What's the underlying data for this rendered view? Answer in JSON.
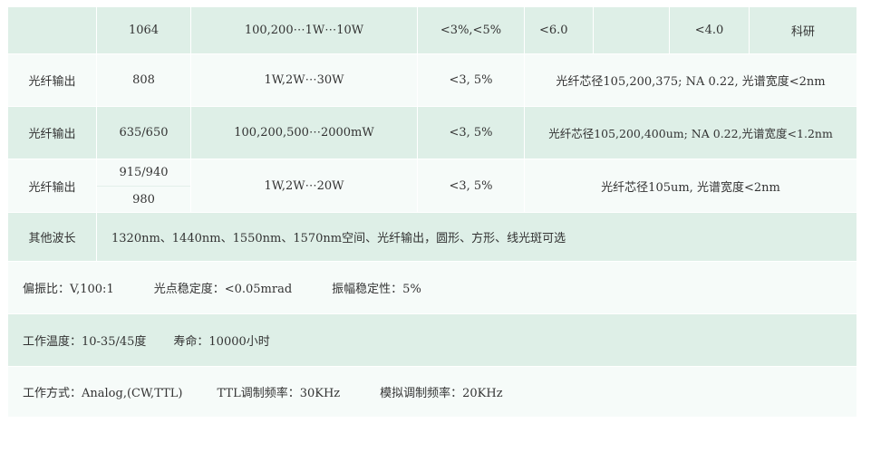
{
  "rows": [
    {
      "name": "",
      "wavelength": "1064",
      "power": "100,200⋯1W⋯10W",
      "stability": "<3%,<5%",
      "col5": "<6.0",
      "col6": "",
      "col7": "<4.0",
      "col8": "科研"
    },
    {
      "name": "光纤输出",
      "wavelength": "808",
      "power": "1W,2W⋯30W",
      "stability": "<3, 5%",
      "note": "光纤芯径105,200,375; NA 0.22, 光谱宽度<2nm"
    },
    {
      "name": "光纤输出",
      "wavelength": "635/650",
      "power": "100,200,500⋯2000mW",
      "stability": "<3, 5%",
      "note": "光纤芯径105,200,400um; NA 0.22,光谱宽度<1.2nm"
    },
    {
      "name": "光纤输出",
      "wavelength_a": "915/940",
      "wavelength_b": "980",
      "power": "1W,2W⋯20W",
      "stability": "<3, 5%",
      "note": "光纤芯径105um, 光谱宽度<2nm"
    }
  ],
  "other": {
    "label": "其他波长",
    "text": "1320nm、1440nm、1550nm、1570nm空间、光纤输出，圆形、方形、线光斑可选"
  },
  "polarization": {
    "ratio": "偏振比：V,100:1",
    "pointing": "光点稳定度：<0.05mrad",
    "amplitude": "振幅稳定性：5%"
  },
  "environment": {
    "temperature": "工作温度：10-35/45度",
    "lifetime": "寿命：10000小时"
  },
  "operation": {
    "mode": "工作方式：Analog,(CW,TTL)",
    "ttl": "TTL调制频率：30KHz",
    "analog": "模拟调制频率：20KHz"
  }
}
